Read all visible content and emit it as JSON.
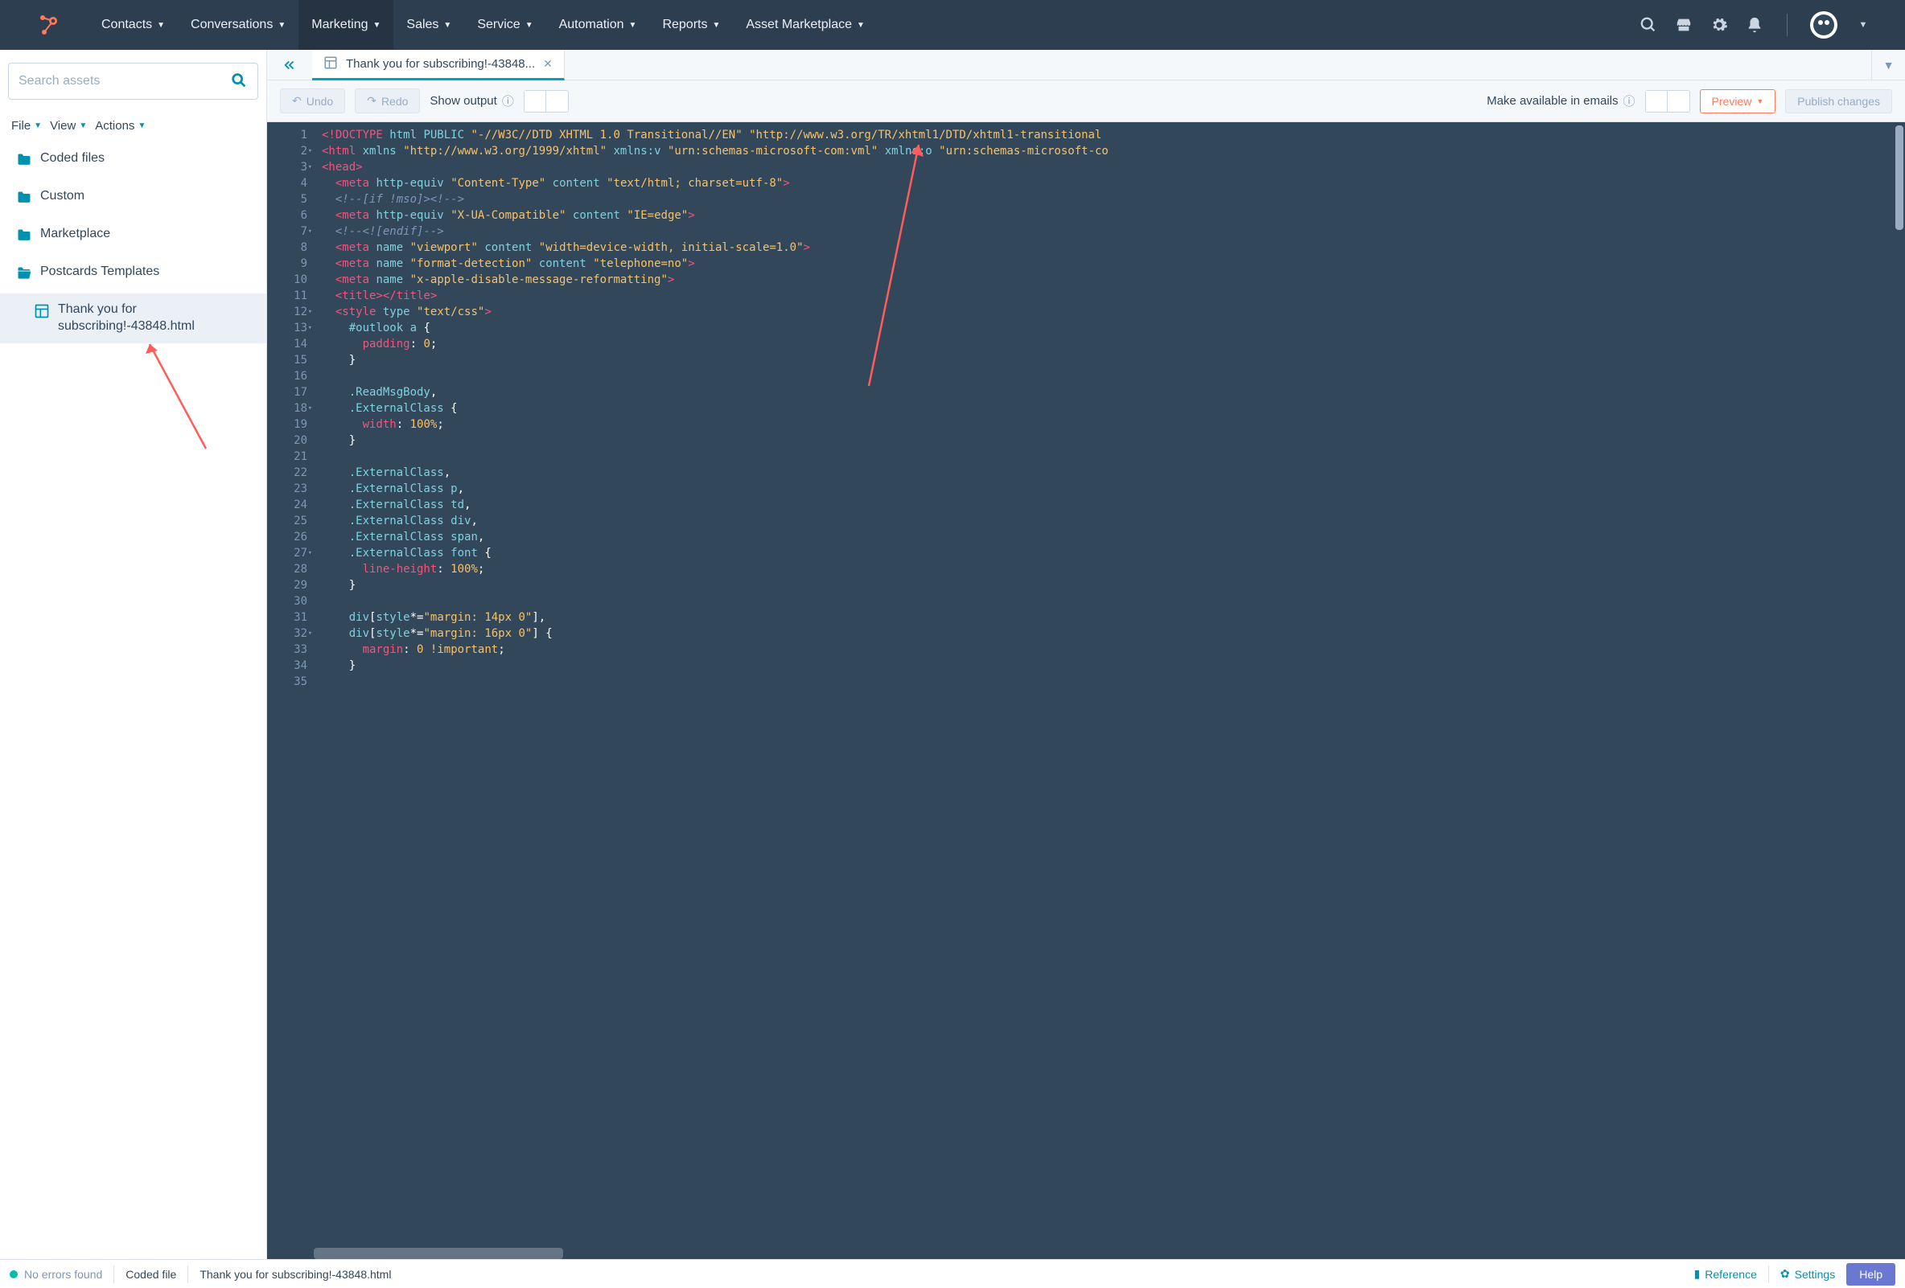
{
  "nav": {
    "items": [
      "Contacts",
      "Conversations",
      "Marketing",
      "Sales",
      "Service",
      "Automation",
      "Reports",
      "Asset Marketplace"
    ],
    "activeIndex": 2
  },
  "sidebar": {
    "searchPlaceholder": "Search assets",
    "menus": [
      "File",
      "View",
      "Actions"
    ],
    "tree": {
      "folders": [
        "Coded files",
        "Custom",
        "Marketplace",
        "Postcards Templates"
      ],
      "openFolderIndex": 3,
      "file": "Thank you for subscribing!-43848.html"
    }
  },
  "tabs": {
    "open": "Thank you for subscribing!-43848..."
  },
  "toolbar": {
    "undo": "Undo",
    "redo": "Redo",
    "showOutput": "Show output",
    "makeAvailable": "Make available in emails",
    "preview": "Preview",
    "publish": "Publish changes"
  },
  "code": {
    "lines": [
      {
        "n": 1,
        "f": "",
        "html": "<span class='tok-tag'>&lt;!DOCTYPE</span> <span class='tok-attr'>html</span> <span class='tok-attr'>PUBLIC</span> <span class='tok-str'>\"-//W3C//DTD XHTML 1.0 Transitional//EN\"</span> <span class='tok-str'>\"http://www.w3.org/TR/xhtml1/DTD/xhtml1-transitional</span>"
      },
      {
        "n": 2,
        "f": "▾",
        "html": "<span class='tok-tag'>&lt;html</span> <span class='tok-attr'>xmlns</span>=<span class='tok-str'>\"http://www.w3.org/1999/xhtml\"</span> <span class='tok-attr'>xmlns:v</span>=<span class='tok-str'>\"urn:schemas-microsoft-com:vml\"</span> <span class='tok-attr'>xmlns:o</span>=<span class='tok-str'>\"urn:schemas-microsoft-co</span>"
      },
      {
        "n": 3,
        "f": "▾",
        "html": "<span class='tok-tag'>&lt;head&gt;</span>"
      },
      {
        "n": 4,
        "f": "",
        "html": "  <span class='tok-tag'>&lt;meta</span> <span class='tok-attr'>http-equiv</span>=<span class='tok-str'>\"Content-Type\"</span> <span class='tok-attr'>content</span>=<span class='tok-str'>\"text/html; charset=utf-8\"</span><span class='tok-tag'>&gt;</span>"
      },
      {
        "n": 5,
        "f": "",
        "html": "  <span class='tok-comment'>&lt;!--[if !mso]&gt;&lt;!--&gt;</span>"
      },
      {
        "n": 6,
        "f": "",
        "html": "  <span class='tok-tag'>&lt;meta</span> <span class='tok-attr'>http-equiv</span>=<span class='tok-str'>\"X-UA-Compatible\"</span> <span class='tok-attr'>content</span>=<span class='tok-str'>\"IE=edge\"</span><span class='tok-tag'>&gt;</span>"
      },
      {
        "n": 7,
        "f": "▾",
        "html": "  <span class='tok-comment'>&lt;!--&lt;![endif]--&gt;</span>"
      },
      {
        "n": 8,
        "f": "",
        "html": "  <span class='tok-tag'>&lt;meta</span> <span class='tok-attr'>name</span>=<span class='tok-str'>\"viewport\"</span> <span class='tok-attr'>content</span>=<span class='tok-str'>\"width=device-width, initial-scale=1.0\"</span><span class='tok-tag'>&gt;</span>"
      },
      {
        "n": 9,
        "f": "",
        "html": "  <span class='tok-tag'>&lt;meta</span> <span class='tok-attr'>name</span>=<span class='tok-str'>\"format-detection\"</span> <span class='tok-attr'>content</span>=<span class='tok-str'>\"telephone=no\"</span><span class='tok-tag'>&gt;</span>"
      },
      {
        "n": 10,
        "f": "",
        "html": "  <span class='tok-tag'>&lt;meta</span> <span class='tok-attr'>name</span>=<span class='tok-str'>\"x-apple-disable-message-reformatting\"</span><span class='tok-tag'>&gt;</span>"
      },
      {
        "n": 11,
        "f": "",
        "html": "  <span class='tok-tag'>&lt;title&gt;&lt;/title&gt;</span>"
      },
      {
        "n": 12,
        "f": "▾",
        "html": "  <span class='tok-tag'>&lt;style</span> <span class='tok-attr'>type</span>=<span class='tok-str'>\"text/css\"</span><span class='tok-tag'>&gt;</span>"
      },
      {
        "n": 13,
        "f": "▾",
        "html": "    <span class='tok-sel'>#outlook</span> <span class='tok-sel'>a</span> <span class='tok-punc'>{</span>"
      },
      {
        "n": 14,
        "f": "",
        "html": "      <span class='tok-prop'>padding</span><span class='tok-punc'>:</span> <span class='tok-val'>0</span><span class='tok-punc'>;</span>"
      },
      {
        "n": 15,
        "f": "",
        "html": "    <span class='tok-punc'>}</span>"
      },
      {
        "n": 16,
        "f": "",
        "html": ""
      },
      {
        "n": 17,
        "f": "",
        "html": "    <span class='tok-sel'>.ReadMsgBody</span><span class='tok-punc'>,</span>"
      },
      {
        "n": 18,
        "f": "▾",
        "html": "    <span class='tok-sel'>.ExternalClass</span> <span class='tok-punc'>{</span>"
      },
      {
        "n": 19,
        "f": "",
        "html": "      <span class='tok-prop'>width</span><span class='tok-punc'>:</span> <span class='tok-val'>100%</span><span class='tok-punc'>;</span>"
      },
      {
        "n": 20,
        "f": "",
        "html": "    <span class='tok-punc'>}</span>"
      },
      {
        "n": 21,
        "f": "",
        "html": ""
      },
      {
        "n": 22,
        "f": "",
        "html": "    <span class='tok-sel'>.ExternalClass</span><span class='tok-punc'>,</span>"
      },
      {
        "n": 23,
        "f": "",
        "html": "    <span class='tok-sel'>.ExternalClass</span> <span class='tok-sel'>p</span><span class='tok-punc'>,</span>"
      },
      {
        "n": 24,
        "f": "",
        "html": "    <span class='tok-sel'>.ExternalClass</span> <span class='tok-sel'>td</span><span class='tok-punc'>,</span>"
      },
      {
        "n": 25,
        "f": "",
        "html": "    <span class='tok-sel'>.ExternalClass</span> <span class='tok-sel'>div</span><span class='tok-punc'>,</span>"
      },
      {
        "n": 26,
        "f": "",
        "html": "    <span class='tok-sel'>.ExternalClass</span> <span class='tok-sel'>span</span><span class='tok-punc'>,</span>"
      },
      {
        "n": 27,
        "f": "▾",
        "html": "    <span class='tok-sel'>.ExternalClass</span> <span class='tok-sel'>font</span> <span class='tok-punc'>{</span>"
      },
      {
        "n": 28,
        "f": "",
        "html": "      <span class='tok-prop'>line-height</span><span class='tok-punc'>:</span> <span class='tok-val'>100%</span><span class='tok-punc'>;</span>"
      },
      {
        "n": 29,
        "f": "",
        "html": "    <span class='tok-punc'>}</span>"
      },
      {
        "n": 30,
        "f": "",
        "html": ""
      },
      {
        "n": 31,
        "f": "",
        "html": "    <span class='tok-sel'>div</span><span class='tok-punc'>[</span><span class='tok-attr'>style</span><span class='tok-punc'>*=</span><span class='tok-str'>\"margin: 14px 0\"</span><span class='tok-punc'>],</span>"
      },
      {
        "n": 32,
        "f": "▾",
        "html": "    <span class='tok-sel'>div</span><span class='tok-punc'>[</span><span class='tok-attr'>style</span><span class='tok-punc'>*=</span><span class='tok-str'>\"margin: 16px 0\"</span><span class='tok-punc'>]</span> <span class='tok-punc'>{</span>"
      },
      {
        "n": 33,
        "f": "",
        "html": "      <span class='tok-prop'>margin</span><span class='tok-punc'>:</span> <span class='tok-val'>0</span> <span class='tok-val'>!important</span><span class='tok-punc'>;</span>"
      },
      {
        "n": 34,
        "f": "",
        "html": "    <span class='tok-punc'>}</span>"
      },
      {
        "n": 35,
        "f": "",
        "html": ""
      }
    ]
  },
  "footer": {
    "errors": "No errors found",
    "type": "Coded file",
    "filename": "Thank you for subscribing!-43848.html",
    "reference": "Reference",
    "settings": "Settings",
    "help": "Help"
  }
}
